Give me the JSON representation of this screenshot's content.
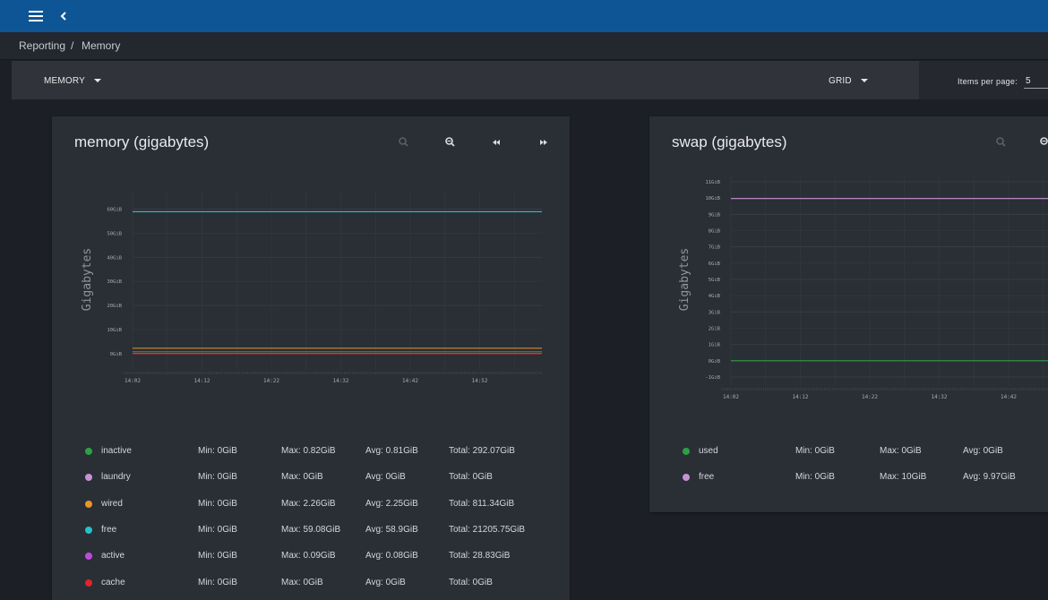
{
  "breadcrumb": {
    "root": "Reporting",
    "separator": "/",
    "current": "Memory"
  },
  "toolbar": {
    "report_select": "MEMORY",
    "view_select": "GRID",
    "items_per_page_label": "Items per page:",
    "items_per_page_value": "5"
  },
  "colors": {
    "topbar": "#0e5596",
    "inactive": "#2ea043",
    "laundry": "#c792d4",
    "wired": "#e7962a",
    "free": "#27c1c9",
    "active": "#c04bd9",
    "cache": "#e0242c",
    "used": "#2ea043",
    "swap_free": "#c792d4"
  },
  "icons": [
    "menu-icon",
    "back-icon",
    "zoom-in-icon",
    "zoom-out-icon",
    "step-back-icon",
    "step-forward-icon",
    "caret-down-icon"
  ],
  "memory": {
    "title": "memory (gigabytes)",
    "legend": [
      {
        "name": "inactive",
        "min": "Min: 0GiB",
        "max": "Max: 0.82GiB",
        "avg": "Avg: 0.81GiB",
        "total": "Total: 292.07GiB"
      },
      {
        "name": "laundry",
        "min": "Min: 0GiB",
        "max": "Max: 0GiB",
        "avg": "Avg: 0GiB",
        "total": "Total: 0GiB"
      },
      {
        "name": "wired",
        "min": "Min: 0GiB",
        "max": "Max: 2.26GiB",
        "avg": "Avg: 2.25GiB",
        "total": "Total: 811.34GiB"
      },
      {
        "name": "free",
        "min": "Min: 0GiB",
        "max": "Max: 59.08GiB",
        "avg": "Avg: 58.9GiB",
        "total": "Total: 21205.75GiB"
      },
      {
        "name": "active",
        "min": "Min: 0GiB",
        "max": "Max: 0.09GiB",
        "avg": "Avg: 0.08GiB",
        "total": "Total: 28.83GiB"
      },
      {
        "name": "cache",
        "min": "Min: 0GiB",
        "max": "Max: 0GiB",
        "avg": "Avg: 0GiB",
        "total": "Total: 0GiB"
      }
    ]
  },
  "swap": {
    "title": "swap (gigabytes)",
    "legend": [
      {
        "name": "used",
        "min": "Min: 0GiB",
        "max": "Max: 0GiB",
        "avg": "Avg: 0GiB"
      },
      {
        "name": "free",
        "min": "Min: 0GiB",
        "max": "Max: 10GiB",
        "avg": "Avg: 9.97GiB"
      }
    ]
  },
  "chart_data": [
    {
      "type": "line",
      "title": "memory (gigabytes)",
      "ylabel": "Gigabytes",
      "xlabel": "",
      "x_ticks": [
        "14:02",
        "14:12",
        "14:22",
        "14:32",
        "14:42",
        "14:52"
      ],
      "y_ticks": [
        "0GiB",
        "10GiB",
        "20GiB",
        "30GiB",
        "40GiB",
        "50GiB",
        "60GiB"
      ],
      "ylim": [
        -3,
        65
      ],
      "grid": true,
      "series": [
        {
          "name": "inactive",
          "color": "#2ea043",
          "values": [
            0.81,
            0.81
          ]
        },
        {
          "name": "laundry",
          "color": "#c792d4",
          "values": [
            0,
            0
          ]
        },
        {
          "name": "wired",
          "color": "#e7962a",
          "values": [
            2.25,
            2.25
          ]
        },
        {
          "name": "free",
          "color": "#27c1c9",
          "values": [
            58.9,
            58.9
          ]
        },
        {
          "name": "active",
          "color": "#c04bd9",
          "values": [
            0.08,
            0.08
          ]
        },
        {
          "name": "cache",
          "color": "#e0242c",
          "values": [
            0,
            0
          ]
        }
      ]
    },
    {
      "type": "line",
      "title": "swap (gigabytes)",
      "ylabel": "Gigabytes",
      "xlabel": "",
      "x_ticks": [
        "14:02",
        "14:12",
        "14:22",
        "14:32",
        "14:42"
      ],
      "y_ticks": [
        "-1GiB",
        "0GiB",
        "1GiB",
        "2GiB",
        "3GiB",
        "4GiB",
        "5GiB",
        "6GiB",
        "7GiB",
        "8GiB",
        "9GiB",
        "10GiB",
        "11GiB"
      ],
      "ylim": [
        -1,
        11
      ],
      "grid": true,
      "series": [
        {
          "name": "used",
          "color": "#2ea043",
          "values": [
            0,
            0
          ]
        },
        {
          "name": "free",
          "color": "#c792d4",
          "values": [
            9.97,
            9.97
          ]
        }
      ]
    }
  ]
}
